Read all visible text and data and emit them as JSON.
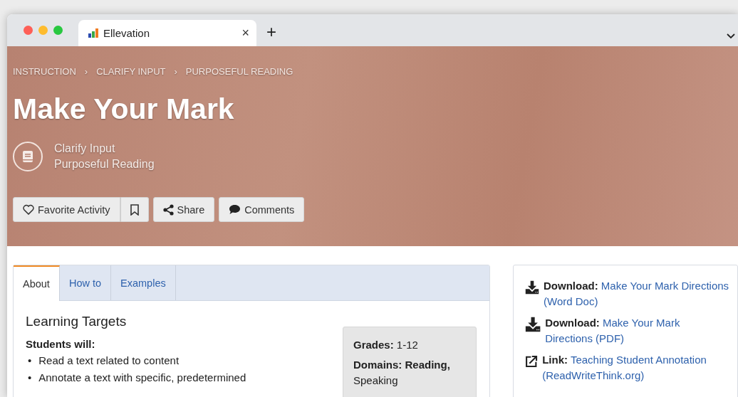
{
  "browser_tab": {
    "title": "Ellevation",
    "close": "×",
    "new_tab": "+"
  },
  "breadcrumbs": [
    "INSTRUCTION",
    "CLARIFY INPUT",
    "PURPOSEFUL READING"
  ],
  "breadcrumb_separator": "›",
  "title": "Make Your Mark",
  "categories": [
    "Clarify Input",
    "Purposeful Reading"
  ],
  "actions": [
    {
      "kind": "favorite",
      "label": "Favorite Activity"
    },
    {
      "kind": "bookmark"
    },
    {
      "kind": "share",
      "label": "Share"
    },
    {
      "kind": "comments",
      "label": "Comments"
    }
  ],
  "tabs": [
    {
      "label": "About",
      "selected": true
    },
    {
      "label": "How to",
      "selected": false
    },
    {
      "label": "Examples",
      "selected": false
    }
  ],
  "about": {
    "heading": "Learning Targets",
    "intro": "Students will:",
    "bullet": "•",
    "targets": [
      "Read a text related to content",
      "Annotate a text with specific, predetermined"
    ]
  },
  "info": [
    "**Grades:** 1-12",
    "**Domains: Reading,** Speaking"
  ],
  "resources": [
    {
      "kind": "download",
      "label": "Download:",
      "link": "Make Your Mark Directions (Word Doc)"
    },
    {
      "kind": "download",
      "label": "Download:",
      "link": "Make Your Mark Directions (PDF)"
    },
    {
      "kind": "link",
      "label": "Link:",
      "link": "Teaching Student Annotation (ReadWriteThink.org)"
    }
  ]
}
